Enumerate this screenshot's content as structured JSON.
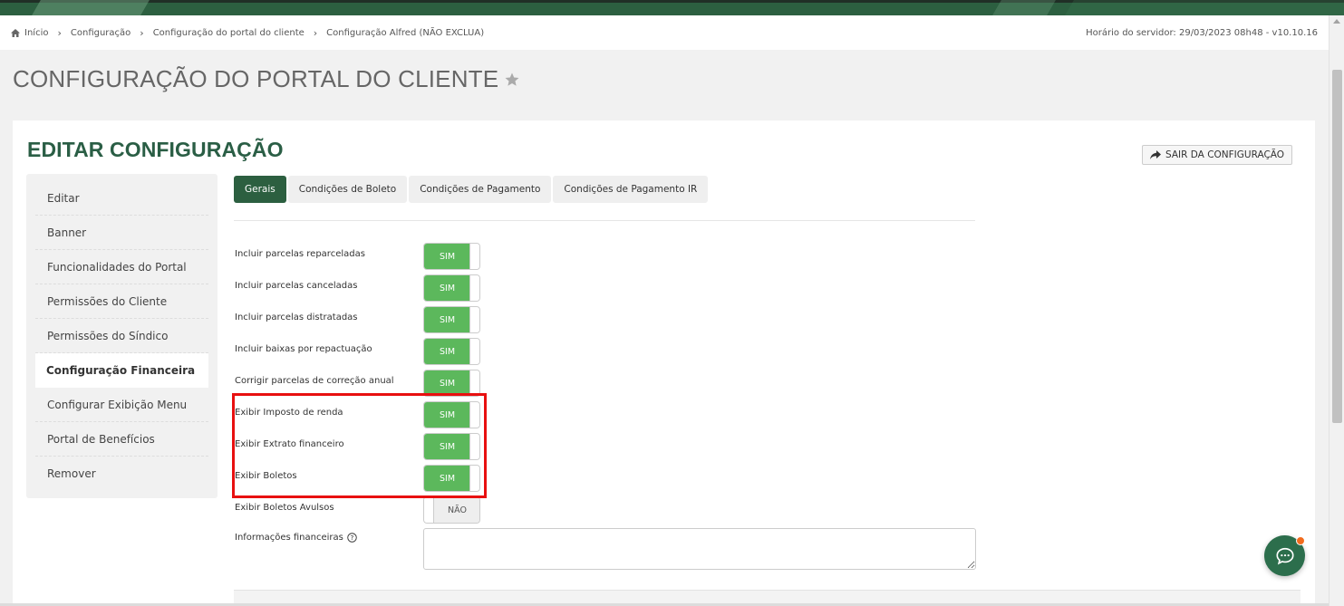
{
  "breadcrumb": {
    "items": [
      "Início",
      "Configuração",
      "Configuração do portal do cliente",
      "Configuração Alfred (NÃO EXCLUA)"
    ],
    "server_time": "Horário do servidor: 29/03/2023 08h48 - v10.10.16"
  },
  "page": {
    "title": "CONFIGURAÇÃO DO PORTAL DO CLIENTE"
  },
  "card": {
    "title": "EDITAR CONFIGURAÇÃO",
    "exit_label": "SAIR DA CONFIGURAÇÃO"
  },
  "sidebar": {
    "items": [
      {
        "label": "Editar"
      },
      {
        "label": "Banner"
      },
      {
        "label": "Funcionalidades do Portal"
      },
      {
        "label": "Permissões do Cliente"
      },
      {
        "label": "Permissões do Síndico"
      },
      {
        "label": "Configuração Financeira"
      },
      {
        "label": "Configurar Exibição Menu"
      },
      {
        "label": "Portal de Benefícios"
      },
      {
        "label": "Remover"
      }
    ],
    "active_index": 5
  },
  "tabs": [
    {
      "label": "Gerais"
    },
    {
      "label": "Condições de Boleto"
    },
    {
      "label": "Condições de Pagamento"
    },
    {
      "label": "Condições de Pagamento IR"
    }
  ],
  "settings": [
    {
      "label": "Incluir parcelas reparceladas",
      "value": "SIM"
    },
    {
      "label": "Incluir parcelas canceladas",
      "value": "SIM"
    },
    {
      "label": "Incluir parcelas distratadas",
      "value": "SIM"
    },
    {
      "label": "Incluir baixas por repactuação",
      "value": "SIM"
    },
    {
      "label": "Corrigir parcelas de correção anual",
      "value": "SIM"
    },
    {
      "label": "Exibir Imposto de renda",
      "value": "SIM"
    },
    {
      "label": "Exibir Extrato financeiro",
      "value": "SIM"
    },
    {
      "label": "Exibir Boletos",
      "value": "SIM"
    },
    {
      "label": "Exibir Boletos Avulsos",
      "value": "NÃO"
    }
  ],
  "info": {
    "label": "Informações financeiras",
    "value": ""
  },
  "colors": {
    "brand_green": "#2c5f40",
    "toggle_on": "#5cb85c",
    "highlight": "#e81010",
    "chat_badge": "#f26b1d"
  }
}
